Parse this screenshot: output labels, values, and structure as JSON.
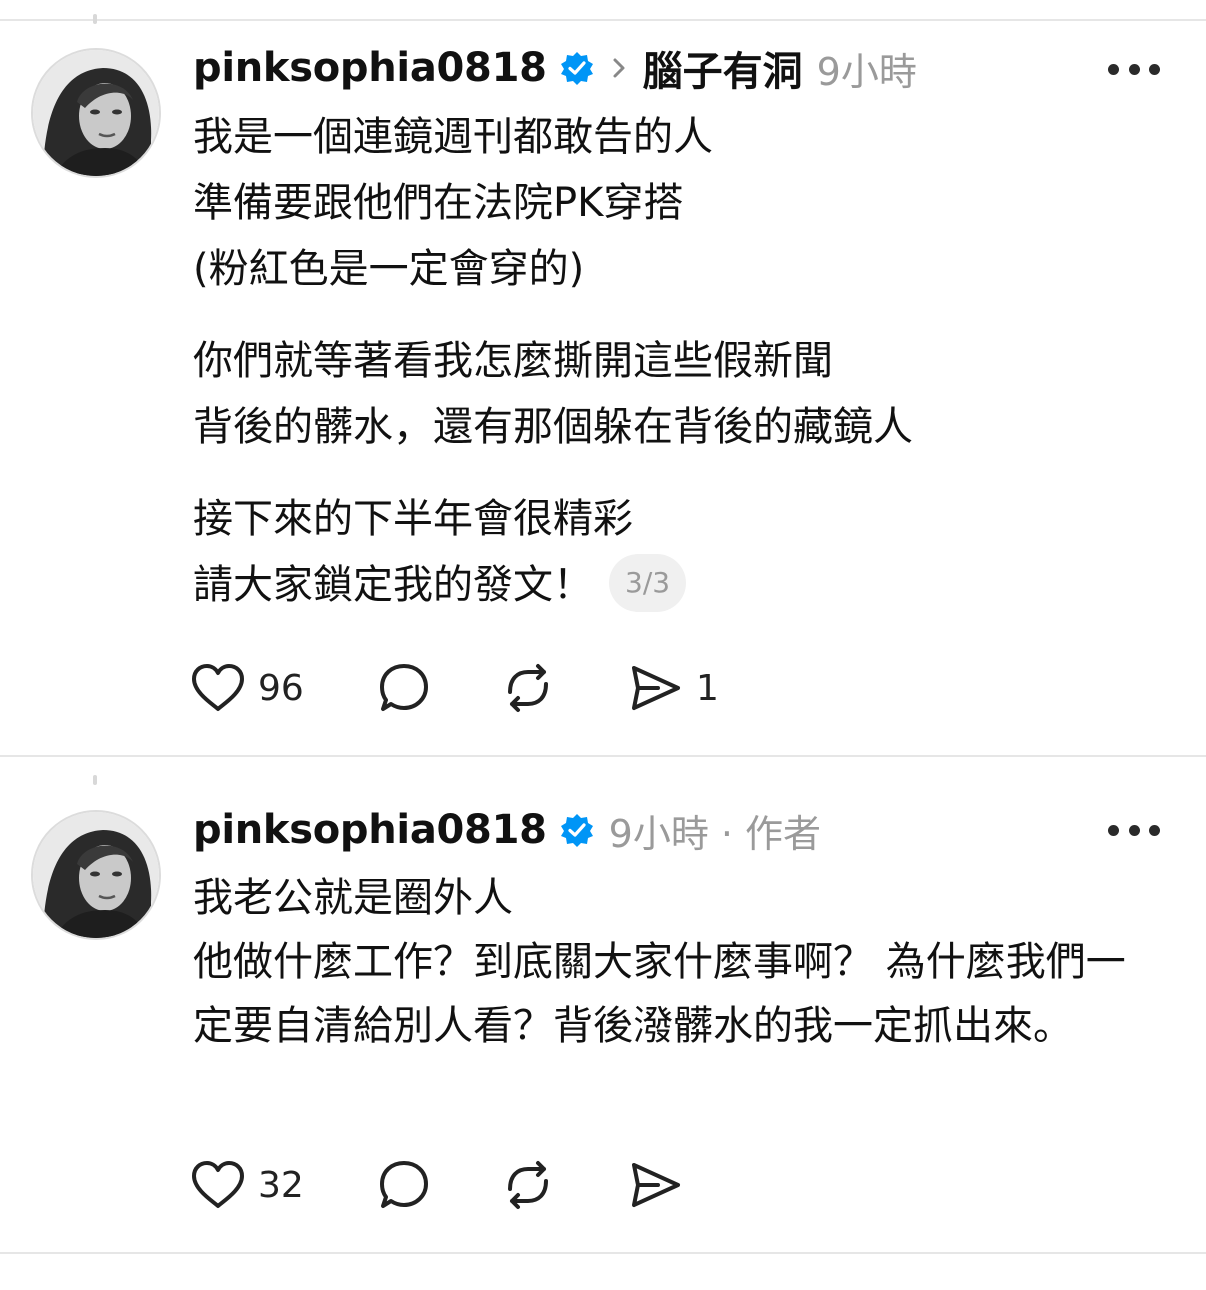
{
  "posts": [
    {
      "username": "pinksophia0818",
      "topic": "腦子有洞",
      "time": "9小時",
      "role": "",
      "paragraphs": [
        [
          "我是一個連鏡週刊都敢告的人",
          "準備要跟他們在法院PK穿搭",
          "(粉紅色是一定會穿的)"
        ],
        [
          "你們就等著看我怎麼撕開這些假新聞",
          "背後的髒水，還有那個躲在背後的藏鏡人"
        ],
        [
          "接下來的下半年會很精彩",
          "請大家鎖定我的發文！"
        ]
      ],
      "pager": "3/3",
      "likes": "96",
      "comments": "",
      "reposts": "",
      "shares": "1",
      "icons": {
        "verified": "verified-badge-icon",
        "chevron": "chevron-right-icon",
        "more": "more-dots-icon",
        "like": "heart-icon",
        "comment": "comment-bubble-icon",
        "repost": "repost-icon",
        "share": "send-icon"
      }
    },
    {
      "username": "pinksophia0818",
      "topic": "",
      "time": "9小時",
      "role": "· 作者",
      "paragraphs": [
        [
          "我老公就是圈外人",
          "他做什麼工作？到底關大家什麼事啊？ 為什麼我們一定要自清給別人看？背後潑髒水的我一定抓出來。"
        ]
      ],
      "pager": "",
      "likes": "32",
      "comments": "",
      "reposts": "",
      "shares": "",
      "icons": {
        "verified": "verified-badge-icon",
        "more": "more-dots-icon",
        "like": "heart-icon",
        "comment": "comment-bubble-icon",
        "repost": "repost-icon",
        "share": "send-icon"
      }
    }
  ],
  "colors": {
    "verified": "#0095f6",
    "meta": "#9a9a9a",
    "text": "#111111",
    "divider": "#e6e6e6"
  }
}
